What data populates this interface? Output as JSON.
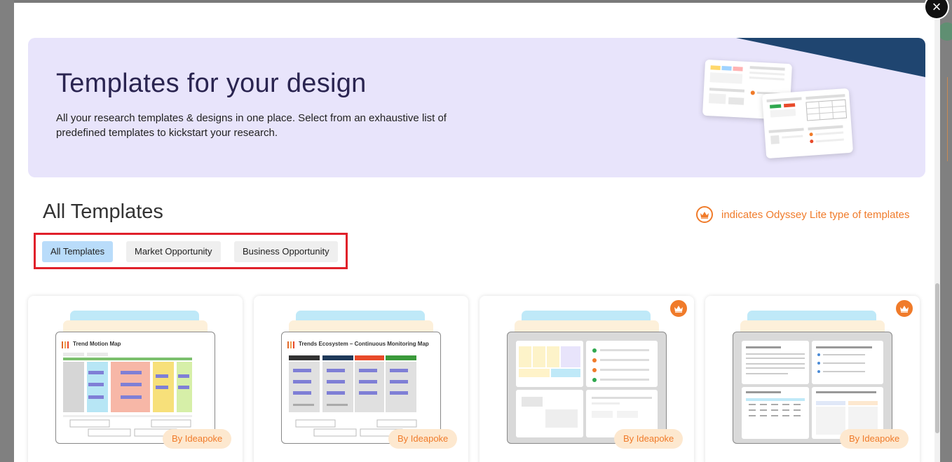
{
  "modal": {
    "close_label": "×"
  },
  "hero": {
    "title": "Templates for your design",
    "description": "All your research templates & designs in one place. Select from an exhaustive list of predefined templates to kickstart your research."
  },
  "section": {
    "title": "All Templates",
    "lite_note": "indicates Odyssey Lite type of templates"
  },
  "filters": [
    {
      "label": "All Templates",
      "active": true
    },
    {
      "label": "Market Opportunity",
      "active": false
    },
    {
      "label": "Business Opportunity",
      "active": false
    }
  ],
  "cards": [
    {
      "preview_title": "Trend Motion Map",
      "badge": "By Ideapoke",
      "lite": false
    },
    {
      "preview_title": "Trends Ecosystem – Continuous Monitoring Map",
      "badge": "By Ideapoke",
      "lite": false
    },
    {
      "preview_title": "",
      "badge": "By Ideapoke",
      "lite": true
    },
    {
      "preview_title": "",
      "badge": "By Ideapoke",
      "lite": true
    }
  ],
  "colors": {
    "accent_orange": "#f07b2a",
    "active_filter": "#b9dcfa",
    "hero_bg": "#e8e4fb",
    "highlight_border": "#e0202a"
  }
}
